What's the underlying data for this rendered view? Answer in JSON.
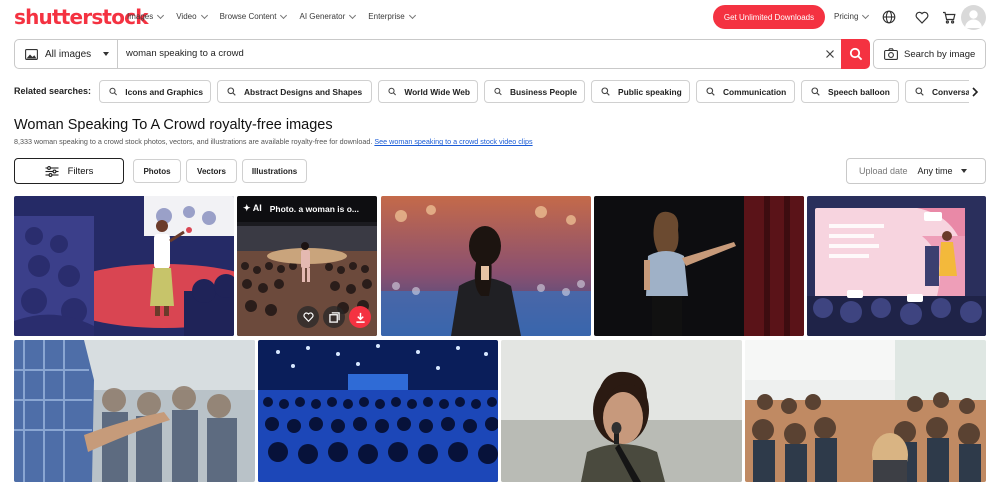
{
  "header": {
    "logo": "shutterstock",
    "nav": [
      {
        "label": "Images"
      },
      {
        "label": "Video"
      },
      {
        "label": "Browse Content"
      },
      {
        "label": "AI Generator"
      },
      {
        "label": "Enterprise"
      }
    ],
    "cta_label": "Get Unlimited Downloads",
    "pricing_label": "Pricing",
    "icons": [
      "globe-icon",
      "heart-icon",
      "cart-icon",
      "user-icon"
    ]
  },
  "search": {
    "scope_label": "All images",
    "query": "woman speaking to a crowd",
    "search_by_image_label": "Search by image"
  },
  "related": {
    "label": "Related searches:",
    "chips": [
      "Icons and Graphics",
      "Abstract Designs and Shapes",
      "World Wide Web",
      "Business People",
      "Public speaking",
      "Communication",
      "Speech balloon",
      "Conversa"
    ]
  },
  "results": {
    "title": "Woman Speaking To A Crowd royalty-free images",
    "subtitle": "8,333 woman speaking to a crowd stock photos, vectors, and illustrations are available royalty-free for download.",
    "video_link": "See woman speaking to a crowd stock video clips"
  },
  "filters": {
    "filters_label": "Filters",
    "tabs": [
      "Photos",
      "Vectors",
      "Illustrations"
    ],
    "sort_label": "Upload date",
    "sort_value": "Any time"
  },
  "images": [
    {
      "alt": "Illustration of a woman speaking on stage to an audience"
    },
    {
      "alt": "AI photo of a woman speaking to a large crowd",
      "badge": "Photo. a woman is o..."
    },
    {
      "alt": "Woman speaker facing a blurred conference audience"
    },
    {
      "alt": "Woman pointing on a dark stage"
    },
    {
      "alt": "Flat illustration of a presenter beside a large screen"
    },
    {
      "alt": "Person gesturing toward a seminar audience"
    },
    {
      "alt": "Large audience in a blue-lit conference hall"
    },
    {
      "alt": "Woman speaking into a microphone outdoors"
    },
    {
      "alt": "Audience seated in a bright lecture hall"
    }
  ],
  "colors": {
    "brand": "#f43241",
    "link": "#1a5bd6"
  }
}
